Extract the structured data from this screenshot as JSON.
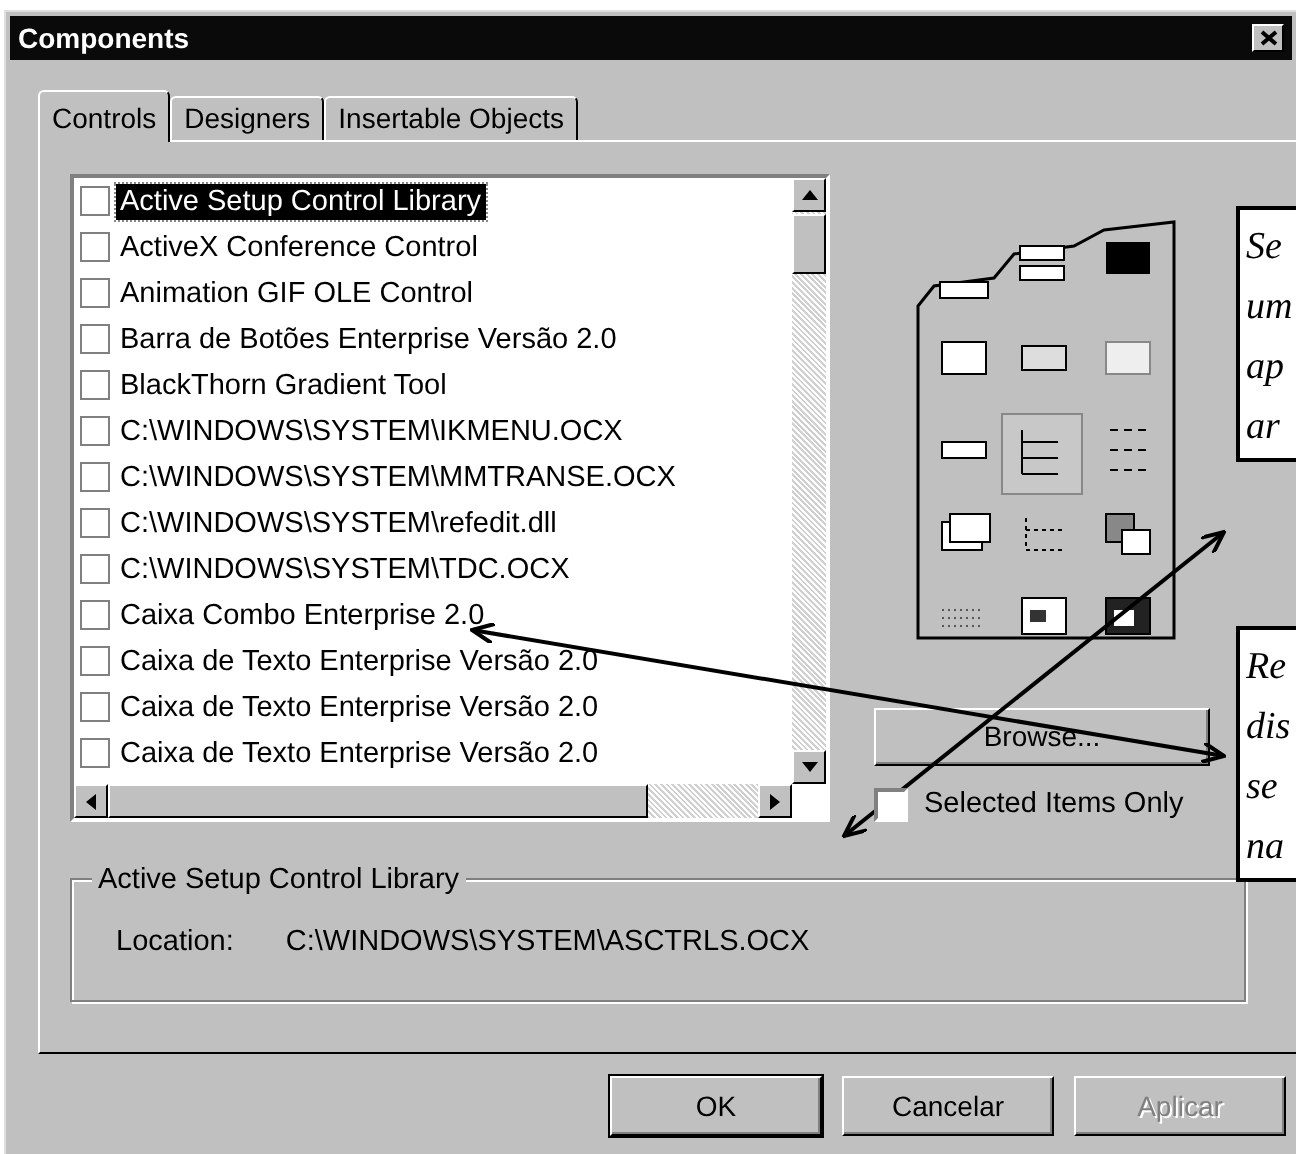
{
  "window": {
    "title": "Components"
  },
  "tabs": [
    {
      "label": "Controls",
      "selected": true
    },
    {
      "label": "Designers",
      "selected": false
    },
    {
      "label": "Insertable Objects",
      "selected": false
    }
  ],
  "component_list": {
    "items": [
      {
        "label": "Active Setup Control Library",
        "checked": false,
        "selected": true
      },
      {
        "label": "ActiveX Conference Control",
        "checked": false,
        "selected": false
      },
      {
        "label": "Animation GIF OLE Control",
        "checked": false,
        "selected": false
      },
      {
        "label": "Barra de Botões Enterprise Versão 2.0",
        "checked": false,
        "selected": false
      },
      {
        "label": "BlackThorn Gradient Tool",
        "checked": false,
        "selected": false
      },
      {
        "label": "C:\\WINDOWS\\SYSTEM\\IKMENU.OCX",
        "checked": false,
        "selected": false
      },
      {
        "label": "C:\\WINDOWS\\SYSTEM\\MMTRANSE.OCX",
        "checked": false,
        "selected": false
      },
      {
        "label": "C:\\WINDOWS\\SYSTEM\\refedit.dll",
        "checked": false,
        "selected": false
      },
      {
        "label": "C:\\WINDOWS\\SYSTEM\\TDC.OCX",
        "checked": false,
        "selected": false
      },
      {
        "label": "Caixa Combo Enterprise 2.0",
        "checked": false,
        "selected": false
      },
      {
        "label": "Caixa de Texto Enterprise Versão 2.0",
        "checked": false,
        "selected": false
      },
      {
        "label": "Caixa de Texto Enterprise Versão 2.0",
        "checked": false,
        "selected": false
      },
      {
        "label": "Caixa de Texto Enterprise Versão 2.0",
        "checked": false,
        "selected": false
      }
    ]
  },
  "browse_button": {
    "label": "Browse..."
  },
  "selected_items_only": {
    "label": "Selected Items Only",
    "checked": false
  },
  "details": {
    "title": "Active Setup Control Library",
    "location_label": "Location:",
    "location_value": "C:\\WINDOWS\\SYSTEM\\ASCTRLS.OCX"
  },
  "buttons": [
    {
      "label": "OK",
      "disabled": false
    },
    {
      "label": "Cancelar",
      "disabled": false
    },
    {
      "label": "Aplicar",
      "disabled": true
    }
  ],
  "callouts": [
    {
      "lines": [
        "Se",
        "um",
        "ap",
        "ar"
      ]
    },
    {
      "lines": [
        "Re",
        "dis",
        "se",
        "na"
      ]
    }
  ]
}
